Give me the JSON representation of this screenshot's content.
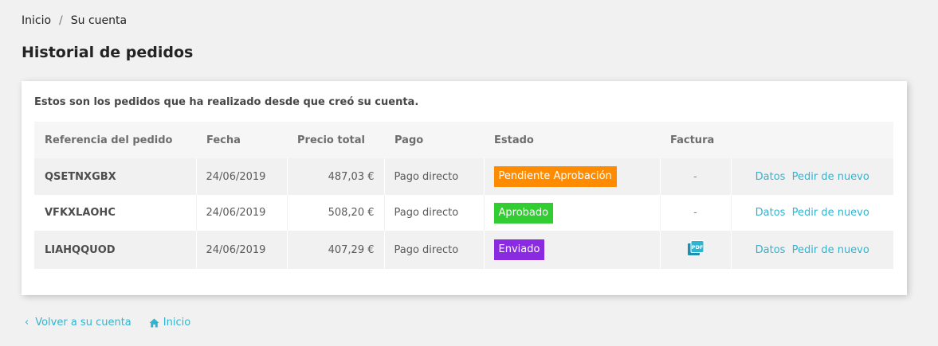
{
  "breadcrumb": {
    "home": "Inicio",
    "separator": "/",
    "current": "Su cuenta"
  },
  "page_title": "Historial de pedidos",
  "intro": "Estos son los pedidos que ha realizado desde que creó su cuenta.",
  "table": {
    "headers": [
      "Referencia del pedido",
      "Fecha",
      "Precio total",
      "Pago",
      "Estado",
      "Factura",
      ""
    ],
    "rows": [
      {
        "reference": "QSETNXGBX",
        "date": "24/06/2019",
        "total": "487,03 €",
        "payment": "Pago directo",
        "status": "Pendiente Aprobación",
        "status_color": "#ff8c00",
        "invoice": "-",
        "details_label": "Datos",
        "reorder_label": "Pedir de nuevo"
      },
      {
        "reference": "VFKXLAOHC",
        "date": "24/06/2019",
        "total": "508,20 €",
        "payment": "Pago directo",
        "status": "Aprobado",
        "status_color": "#32cd32",
        "invoice": "-",
        "details_label": "Datos",
        "reorder_label": "Pedir de nuevo"
      },
      {
        "reference": "LIAHQQUOD",
        "date": "24/06/2019",
        "total": "407,29 €",
        "payment": "Pago directo",
        "status": "Enviado",
        "status_color": "#8a2be2",
        "invoice_icon": "pdf-icon",
        "details_label": "Datos",
        "reorder_label": "Pedir de nuevo"
      }
    ]
  },
  "footer": {
    "back_label": "Volver a su cuenta",
    "home_label": "Inicio"
  },
  "colors": {
    "accent": "#2fb5d2"
  }
}
